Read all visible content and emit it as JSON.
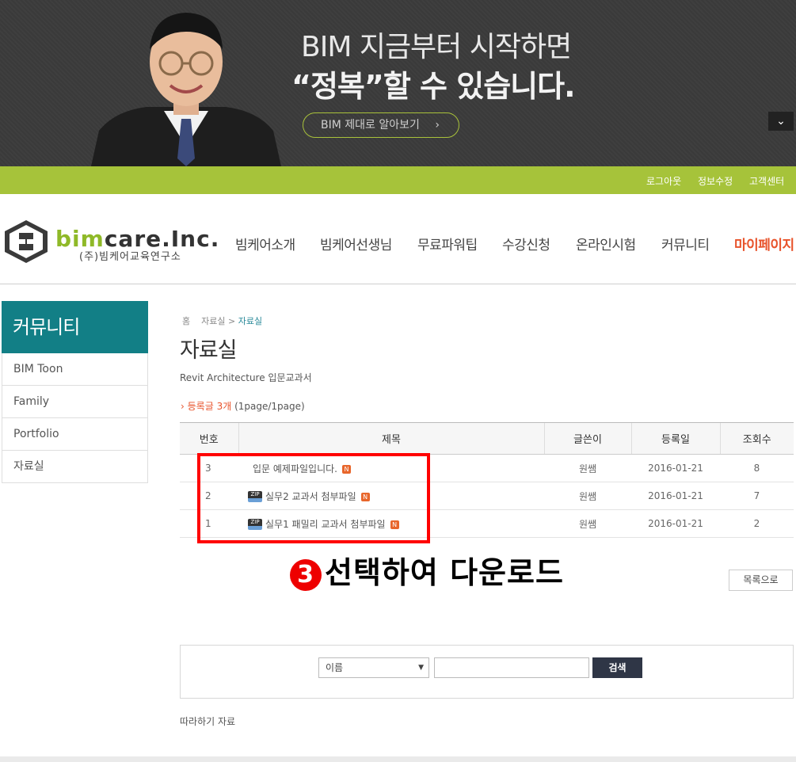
{
  "banner": {
    "line1": "BIM 지금부터 시작하면",
    "line2": "“정복”할 수 있습니다.",
    "button_label": "BIM 제대로 알아보기",
    "button_chevron": "›",
    "toggle_icon": "chevron-down-icon",
    "toggle_glyph": "⌄"
  },
  "utilbar": {
    "logout": "로그아웃",
    "edit_info": "정보수정",
    "support": "고객센터",
    "color": "#a6c33a"
  },
  "logo": {
    "name_part1": "bim",
    "name_part2": "care.Inc.",
    "sub": "(주)빔케어교육연구소"
  },
  "gnb": [
    "빔케어소개",
    "빔케어선생님",
    "무료파워팁",
    "수강신청",
    "온라인시험",
    "커뮤니티",
    "마이페이지"
  ],
  "sidebar": {
    "title": "커뮤니티",
    "items": [
      "BIM Toon",
      "Family",
      "Portfolio",
      "자료실"
    ],
    "accent": "#127f86"
  },
  "breadcrumb": {
    "home": "홈",
    "sep": ">",
    "parent": "자료실",
    "current": "자료실"
  },
  "main": {
    "title": "자료실",
    "description": "Revit Architecture 입문교과서",
    "count_prefix": "› 등록글",
    "count_value": "3개",
    "count_pages": "(1page/1page)"
  },
  "table": {
    "headers": [
      "번호",
      "제목",
      "글쓴이",
      "등록일",
      "조회수"
    ],
    "rows": [
      {
        "no": "3",
        "title": "입문 예제파일입니다.",
        "zip": false,
        "author": "원쌤",
        "date": "2016-01-21",
        "views": "8"
      },
      {
        "no": "2",
        "title": "실무2 교과서 첨부파일",
        "zip": true,
        "author": "원쌤",
        "date": "2016-01-21",
        "views": "7"
      },
      {
        "no": "1",
        "title": "실무1 패밀리 교과서 첨부파일",
        "zip": true,
        "author": "원쌤",
        "date": "2016-01-21",
        "views": "2"
      }
    ],
    "new_badge": "N",
    "zip_label": "ZIP"
  },
  "annotation": {
    "number": "3",
    "text": "선택하여 다운로드",
    "color": "#ff0000"
  },
  "list_button": "목록으로",
  "search": {
    "select_value": "이름",
    "select_arrow": "▼",
    "input_value": "",
    "button": "검색"
  },
  "footer_note": "따라하기 자료"
}
